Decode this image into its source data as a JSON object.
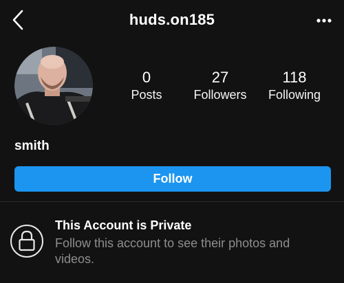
{
  "header": {
    "title": "huds.on185",
    "back_icon": "chevron-left-icon",
    "more_icon": "more-horizontal-icon"
  },
  "profile": {
    "username": "smith",
    "stats": {
      "posts": {
        "value": "0",
        "label": "Posts"
      },
      "followers": {
        "value": "27",
        "label": "Followers"
      },
      "following": {
        "value": "118",
        "label": "Following"
      }
    },
    "follow_label": "Follow"
  },
  "private_notice": {
    "title": "This Account is Private",
    "subtitle": "Follow this account to see their photos and videos.",
    "icon": "lock-icon"
  },
  "colors": {
    "background": "#121212",
    "accent": "#1c95f0",
    "muted_text": "#8e8e8e"
  }
}
